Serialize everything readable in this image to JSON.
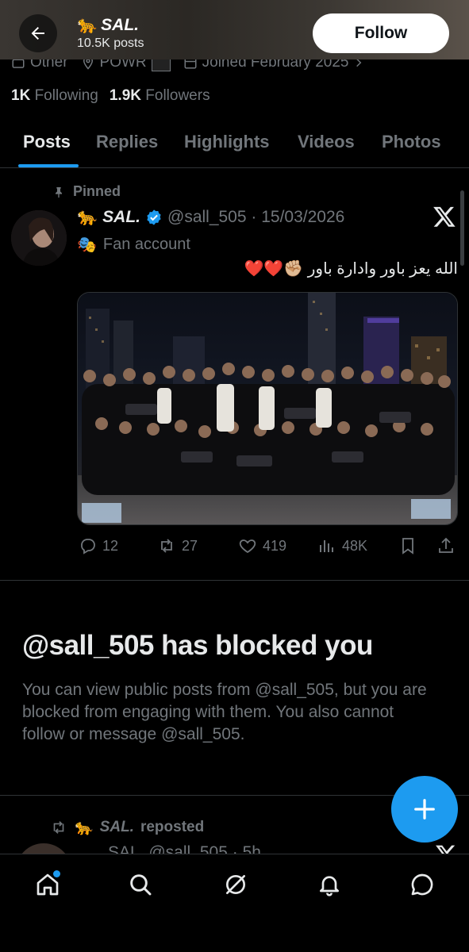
{
  "header": {
    "emoji": "🐆",
    "name": "SAL.",
    "posts_count": "10.5K posts",
    "follow_label": "Follow"
  },
  "meta": {
    "category": "Other",
    "link": "POWR",
    "joined": "Joined February 2025"
  },
  "stats": {
    "following_count": "1K",
    "following_label": "Following",
    "followers_count": "1.9K",
    "followers_label": "Followers"
  },
  "tabs": [
    {
      "label": "Posts"
    },
    {
      "label": "Replies"
    },
    {
      "label": "Highlights"
    },
    {
      "label": "Videos"
    },
    {
      "label": "Photos"
    }
  ],
  "pinned_post": {
    "pinned_label": "Pinned",
    "emoji": "🐆",
    "name": "SAL.",
    "handle_date": "@sall_505 · 15/03/2026",
    "fan_emoji": "🎭",
    "fan_label": "Fan account",
    "text": "الله يعز باور وادارة باور ✊🏼❤️❤️",
    "replies": "12",
    "reposts": "27",
    "likes": "419",
    "views": "48K"
  },
  "blocked": {
    "title": "@sall_505 has blocked you",
    "description": "You can view public posts from @sall_505, but you are blocked from engaging with them. You also cannot follow or message @sall_505."
  },
  "repost": {
    "emoji": "🐆",
    "name": "SAL.",
    "label": "reposted",
    "cut_text": "SAL. @sall_505 · 5h"
  },
  "colors": {
    "accent": "#1d9bf0",
    "muted": "#71767b",
    "text": "#e7e9ea",
    "background": "#000000",
    "border": "#2f3336",
    "verified": "#1d9bf0"
  },
  "icons": {
    "back": "arrow-left-icon",
    "pin": "pin-icon",
    "verified": "verified-badge-icon",
    "x_logo": "x-logo-icon",
    "nav": [
      "home-icon",
      "search-icon",
      "grok-icon",
      "bell-icon",
      "messages-icon"
    ]
  }
}
